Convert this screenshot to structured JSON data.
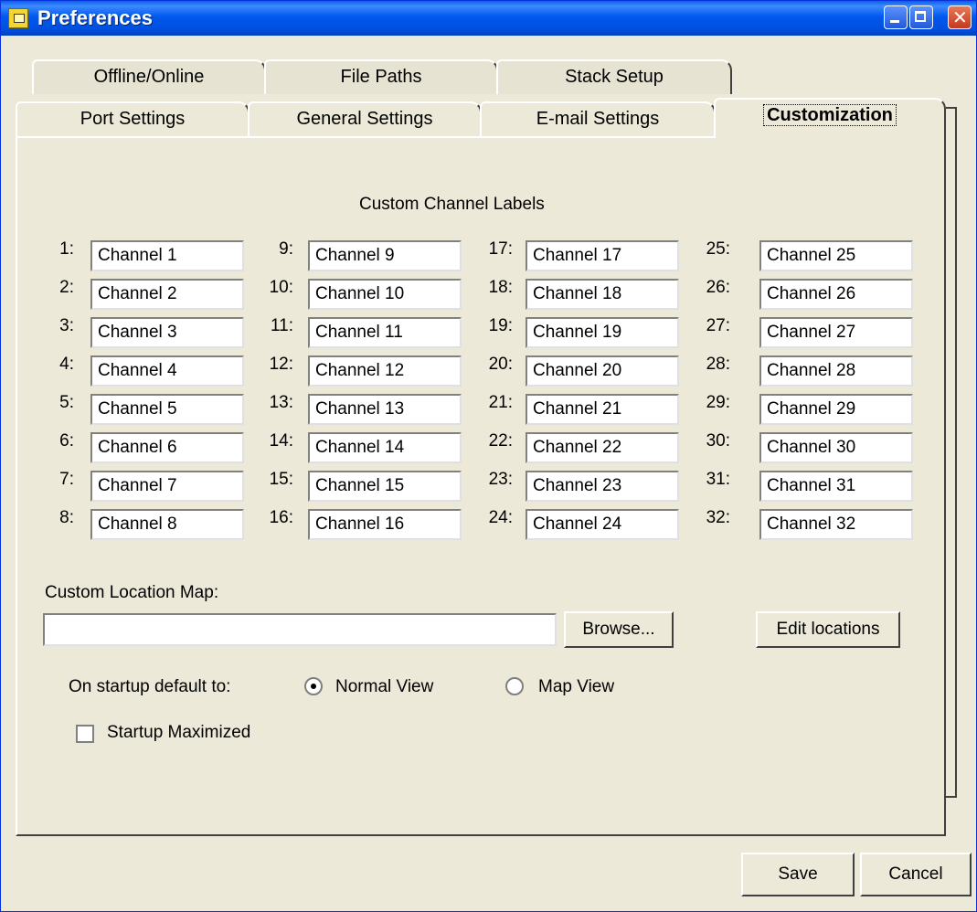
{
  "window": {
    "title": "Preferences"
  },
  "tabs_back": [
    {
      "label": "Offline/Online"
    },
    {
      "label": "File Paths"
    },
    {
      "label": "Stack Setup"
    }
  ],
  "tabs_front": [
    {
      "label": "Port Settings"
    },
    {
      "label": "General Settings"
    },
    {
      "label": "E-mail Settings"
    },
    {
      "label": "Customization"
    }
  ],
  "active_tab": "Customization",
  "custom_channel_labels": {
    "title": "Custom Channel Labels",
    "channels": [
      {
        "num": "1:",
        "value": "Channel 1"
      },
      {
        "num": "2:",
        "value": "Channel 2"
      },
      {
        "num": "3:",
        "value": "Channel 3"
      },
      {
        "num": "4:",
        "value": "Channel 4"
      },
      {
        "num": "5:",
        "value": "Channel 5"
      },
      {
        "num": "6:",
        "value": "Channel 6"
      },
      {
        "num": "7:",
        "value": "Channel 7"
      },
      {
        "num": "8:",
        "value": "Channel 8"
      },
      {
        "num": "9:",
        "value": "Channel 9"
      },
      {
        "num": "10:",
        "value": "Channel 10"
      },
      {
        "num": "11:",
        "value": "Channel 11"
      },
      {
        "num": "12:",
        "value": "Channel 12"
      },
      {
        "num": "13:",
        "value": "Channel 13"
      },
      {
        "num": "14:",
        "value": "Channel 14"
      },
      {
        "num": "15:",
        "value": "Channel 15"
      },
      {
        "num": "16:",
        "value": "Channel 16"
      },
      {
        "num": "17:",
        "value": "Channel 17"
      },
      {
        "num": "18:",
        "value": "Channel 18"
      },
      {
        "num": "19:",
        "value": "Channel 19"
      },
      {
        "num": "20:",
        "value": "Channel 20"
      },
      {
        "num": "21:",
        "value": "Channel 21"
      },
      {
        "num": "22:",
        "value": "Channel 22"
      },
      {
        "num": "23:",
        "value": "Channel 23"
      },
      {
        "num": "24:",
        "value": "Channel 24"
      },
      {
        "num": "25:",
        "value": "Channel 25"
      },
      {
        "num": "26:",
        "value": "Channel 26"
      },
      {
        "num": "27:",
        "value": "Channel 27"
      },
      {
        "num": "28:",
        "value": "Channel 28"
      },
      {
        "num": "29:",
        "value": "Channel 29"
      },
      {
        "num": "30:",
        "value": "Channel 30"
      },
      {
        "num": "31:",
        "value": "Channel 31"
      },
      {
        "num": "32:",
        "value": "Channel 32"
      }
    ]
  },
  "location_map": {
    "label": "Custom Location Map:",
    "value": "",
    "browse_label": "Browse...",
    "edit_label": "Edit locations"
  },
  "startup": {
    "label": "On startup default to:",
    "options": [
      {
        "label": "Normal View",
        "checked": true
      },
      {
        "label": "Map View",
        "checked": false
      }
    ],
    "maximized_label": "Startup Maximized",
    "maximized_checked": false
  },
  "footer": {
    "save_label": "Save",
    "cancel_label": "Cancel"
  },
  "icons": {
    "app": "preferences-app-icon",
    "minimize": "minimize-icon",
    "maximize": "maximize-icon",
    "close": "close-icon"
  }
}
